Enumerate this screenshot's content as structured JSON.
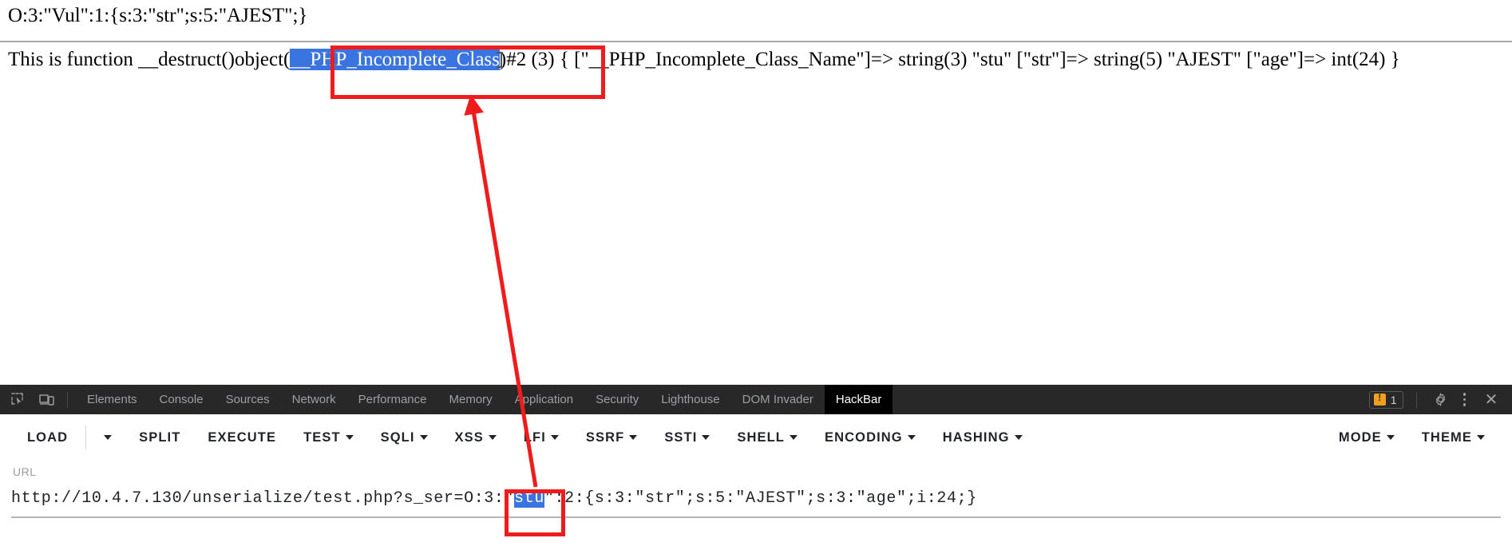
{
  "page": {
    "line1": "O:3:\"Vul\":1:{s:3:\"str\";s:5:\"AJEST\";}",
    "line2_before": "This is function __destruct()object(",
    "line2_selected": "__PHP_Incomplete_Class",
    "line2_after": ")#2 (3) { [\"__PHP_Incomplete_Class_Name\"]=> string(3) \"stu\" [\"str\"]=> string(5) \"AJEST\" [\"age\"]=> int(24) }"
  },
  "devtools": {
    "icons": {
      "inspect": "inspect-element-icon",
      "device": "device-toolbar-icon",
      "settings": "gear-icon",
      "more": "kebab-menu-icon",
      "close": "close-icon"
    },
    "tabs": [
      {
        "label": "Elements",
        "active": false
      },
      {
        "label": "Console",
        "active": false
      },
      {
        "label": "Sources",
        "active": false
      },
      {
        "label": "Network",
        "active": false
      },
      {
        "label": "Performance",
        "active": false
      },
      {
        "label": "Memory",
        "active": false
      },
      {
        "label": "Application",
        "active": false
      },
      {
        "label": "Security",
        "active": false
      },
      {
        "label": "Lighthouse",
        "active": false
      },
      {
        "label": "DOM Invader",
        "active": false
      },
      {
        "label": "HackBar",
        "active": true
      }
    ],
    "warnings": {
      "count": "1",
      "icon": "warning-icon"
    },
    "close_glyph": "✕",
    "colors": {
      "tabbar_bg": "#282828",
      "active_tab_bg": "#000000",
      "warning": "#f0a020"
    }
  },
  "hackbar": {
    "buttons": [
      {
        "label": "LOAD",
        "caret": false
      },
      {
        "label": "",
        "caret": true
      },
      {
        "label": "SPLIT",
        "caret": false
      },
      {
        "label": "EXECUTE",
        "caret": false
      },
      {
        "label": "TEST",
        "caret": true
      },
      {
        "label": "SQLI",
        "caret": true
      },
      {
        "label": "XSS",
        "caret": true
      },
      {
        "label": "LFI",
        "caret": true
      },
      {
        "label": "SSRF",
        "caret": true
      },
      {
        "label": "SSTI",
        "caret": true
      },
      {
        "label": "SHELL",
        "caret": true
      },
      {
        "label": "ENCODING",
        "caret": true
      },
      {
        "label": "HASHING",
        "caret": true
      }
    ],
    "right_buttons": [
      {
        "label": "MODE",
        "caret": true
      },
      {
        "label": "THEME",
        "caret": true
      }
    ],
    "url_label": "URL",
    "url_before": "http://10.4.7.130/unserialize/test.php?s_ser=O:3:\"",
    "url_selected": "stu",
    "url_after": "\":2:{s:3:\"str\";s:5:\"AJEST\";s:3:\"age\";i:24;}"
  },
  "annotations": {
    "highlight_color": "#ee1c1c",
    "top_box": "highlight-incomplete-class",
    "bottom_box": "highlight-stu-class-name",
    "arrow": "red-arrow-pointing-up"
  }
}
